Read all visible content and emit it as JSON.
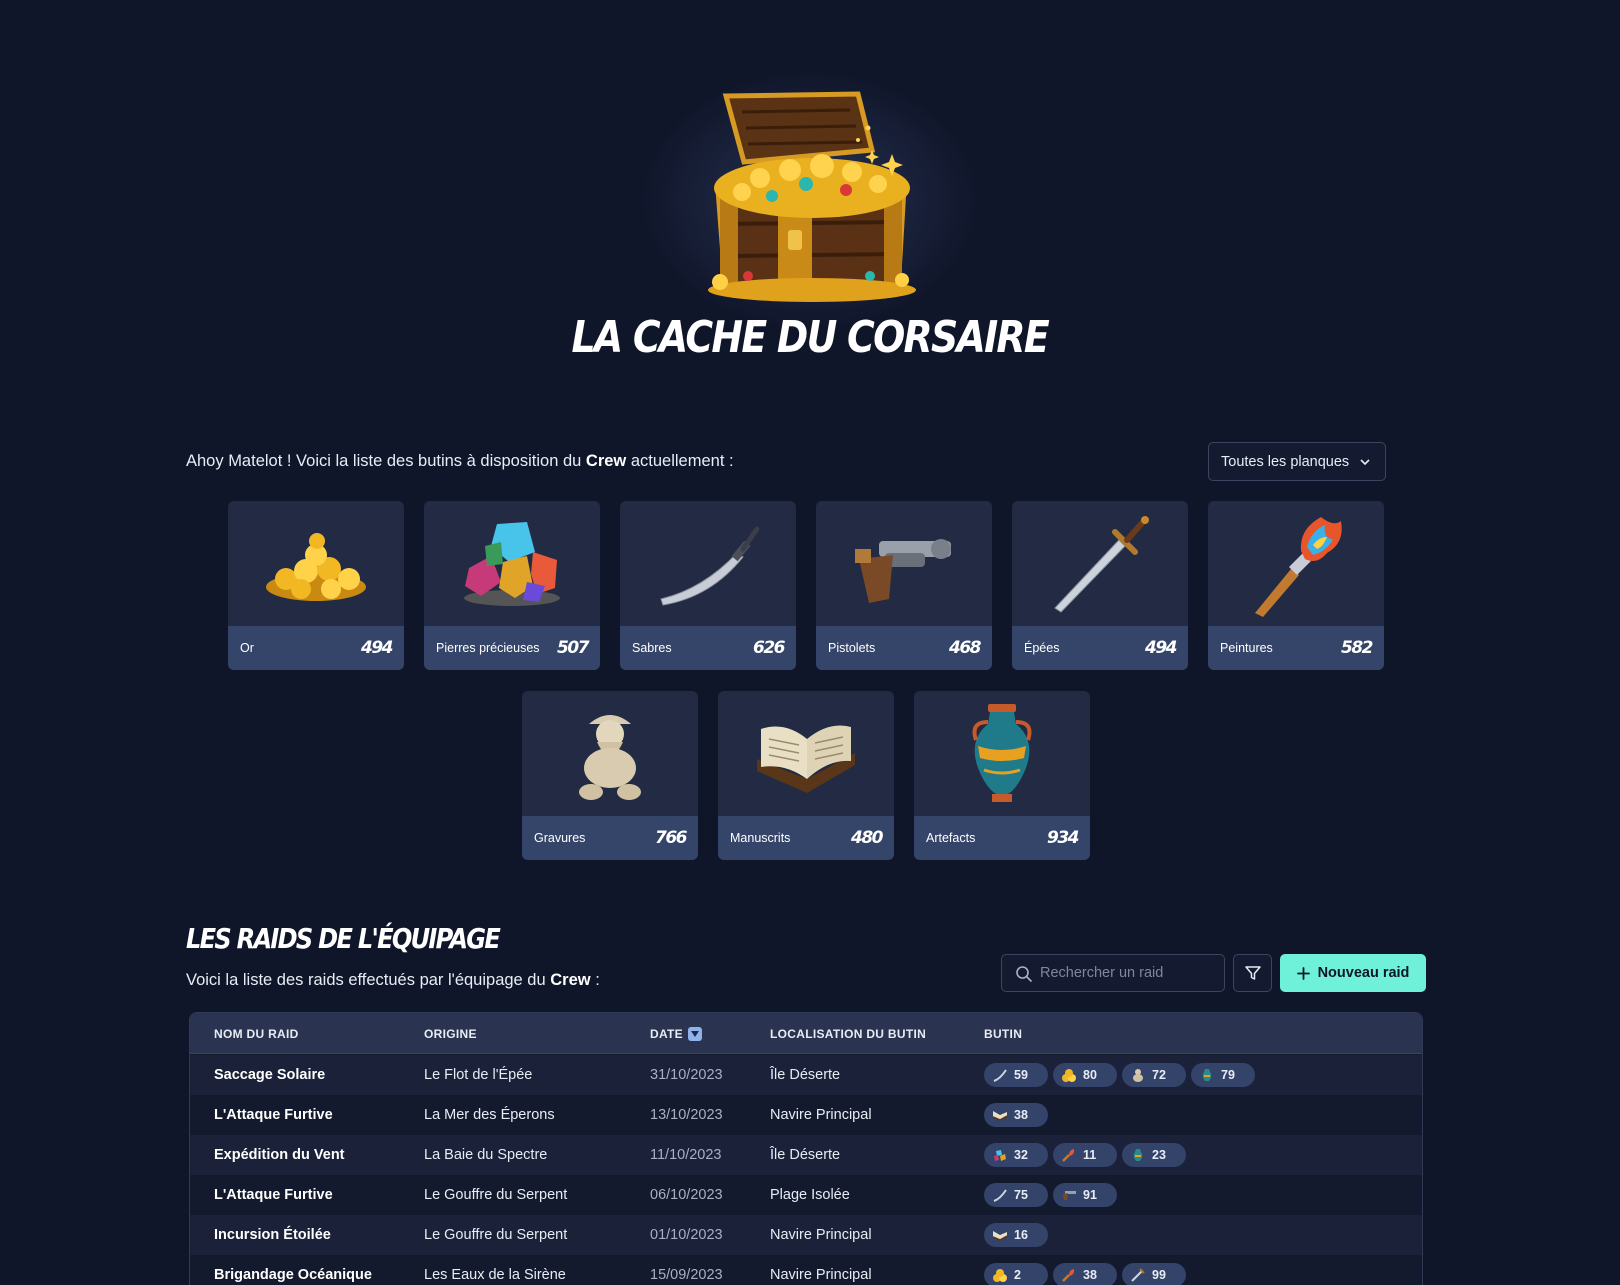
{
  "app": {
    "title": "LA CACHE DU CORSAIRE"
  },
  "intro": {
    "prefix": "Ahoy Matelot ! Voici la liste des butins à disposition du ",
    "crew": "Crew",
    "suffix": " actuellement :"
  },
  "filter_select": {
    "value": "Toutes les planques"
  },
  "loot_categories": [
    {
      "name": "Or",
      "count": "494",
      "icon": "gold-coins-icon"
    },
    {
      "name": "Pierres précieuses",
      "count": "507",
      "icon": "gems-icon"
    },
    {
      "name": "Sabres",
      "count": "626",
      "icon": "saber-icon"
    },
    {
      "name": "Pistolets",
      "count": "468",
      "icon": "pistol-icon"
    },
    {
      "name": "Épées",
      "count": "494",
      "icon": "sword-icon"
    },
    {
      "name": "Peintures",
      "count": "582",
      "icon": "paintbrush-icon"
    },
    {
      "name": "Gravures",
      "count": "766",
      "icon": "statue-icon"
    },
    {
      "name": "Manuscrits",
      "count": "480",
      "icon": "book-icon"
    },
    {
      "name": "Artefacts",
      "count": "934",
      "icon": "vase-icon"
    }
  ],
  "raids": {
    "title": "LES RAIDS DE L'ÉQUIPAGE",
    "subtitle_prefix": "Voici la liste des raids effectués par l'équipage du ",
    "subtitle_crew": "Crew",
    "subtitle_suffix": " :",
    "search_placeholder": "Rechercher un raid",
    "new_button": "Nouveau raid",
    "columns": {
      "name": "NOM DU RAID",
      "origin": "ORIGINE",
      "date": "DATE",
      "location": "LOCALISATION DU BUTIN",
      "loot": "BUTIN"
    },
    "rows": [
      {
        "name": "Saccage Solaire",
        "origin": "Le Flot de l'Épée",
        "date": "31/10/2023",
        "location": "Île Déserte",
        "loot": [
          {
            "icon": "saber-icon",
            "qty": "59"
          },
          {
            "icon": "gold-coins-icon",
            "qty": "80"
          },
          {
            "icon": "statue-icon",
            "qty": "72"
          },
          {
            "icon": "vase-icon",
            "qty": "79"
          }
        ]
      },
      {
        "name": "L'Attaque Furtive",
        "origin": "La Mer des Éperons",
        "date": "13/10/2023",
        "location": "Navire Principal",
        "loot": [
          {
            "icon": "book-icon",
            "qty": "38"
          }
        ]
      },
      {
        "name": "Expédition du Vent",
        "origin": "La Baie du Spectre",
        "date": "11/10/2023",
        "location": "Île Déserte",
        "loot": [
          {
            "icon": "gems-icon",
            "qty": "32"
          },
          {
            "icon": "paintbrush-icon",
            "qty": "11"
          },
          {
            "icon": "vase-icon",
            "qty": "23"
          }
        ]
      },
      {
        "name": "L'Attaque Furtive",
        "origin": "Le Gouffre du Serpent",
        "date": "06/10/2023",
        "location": "Plage Isolée",
        "loot": [
          {
            "icon": "saber-icon",
            "qty": "75"
          },
          {
            "icon": "pistol-icon",
            "qty": "91"
          }
        ]
      },
      {
        "name": "Incursion Étoilée",
        "origin": "Le Gouffre du Serpent",
        "date": "01/10/2023",
        "location": "Navire Principal",
        "loot": [
          {
            "icon": "book-icon",
            "qty": "16"
          }
        ]
      },
      {
        "name": "Brigandage Océanique",
        "origin": "Les Eaux de la Sirène",
        "date": "15/09/2023",
        "location": "Navire Principal",
        "loot": [
          {
            "icon": "gold-coins-icon",
            "qty": "2"
          },
          {
            "icon": "paintbrush-icon",
            "qty": "38"
          },
          {
            "icon": "sword-icon",
            "qty": "99"
          }
        ]
      }
    ]
  },
  "colors": {
    "background": "#10162a",
    "card": "#222a44",
    "card_footer": "#35456a",
    "accent": "#6ff0d9"
  }
}
